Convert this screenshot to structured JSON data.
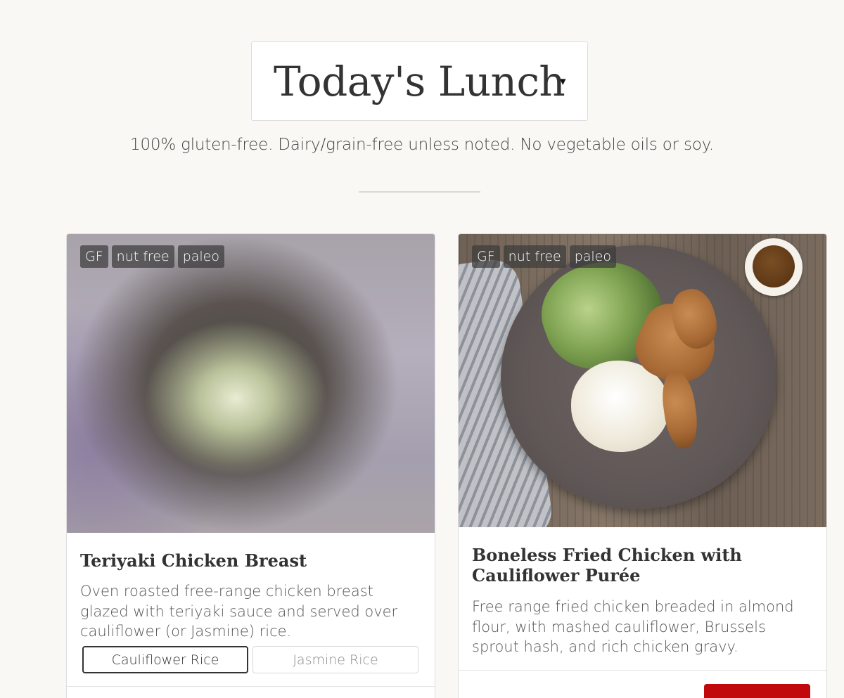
{
  "header": {
    "title": "Today's Lunch",
    "caret": "▾",
    "subtitle": "100% gluten-free. Dairy/grain-free unless noted. No vegetable oils or soy."
  },
  "menu_items": [
    {
      "tags": [
        "GF",
        "nut free",
        "paleo"
      ],
      "title": "Teriyaki Chicken Breast",
      "description": "Oven roasted free-range chicken breast glazed with teriyaki sauce and served over cauliflower (or Jasmine) rice.",
      "options": [
        "Cauliflower Rice",
        "Jasmine Rice"
      ],
      "selected_option": "Cauliflower Rice"
    },
    {
      "tags": [
        "GF",
        "nut free",
        "paleo"
      ],
      "title": "Boneless Fried Chicken with Cauliflower Purée",
      "description": "Free range fried chicken breaded in almond flour, with mashed cauliflower, Brussels sprout hash, and rich chicken gravy."
    }
  ],
  "colors": {
    "background": "#faf8f4",
    "accent_red": "#c0080d",
    "tag_background": "#3c3c3c"
  }
}
